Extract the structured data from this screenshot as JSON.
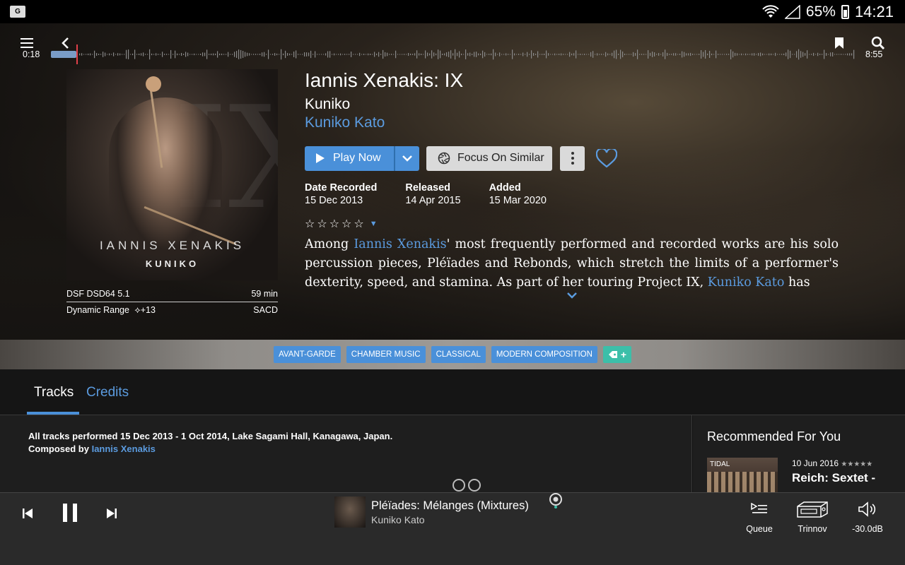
{
  "status_bar": {
    "app_icon_label": "G",
    "battery": "65%",
    "time": "14:21"
  },
  "album": {
    "title": "Iannis Xenakis: IX",
    "artist": "Kuniko",
    "performer": "Kuniko Kato",
    "cover_composer": "IANNIS XENAKIS",
    "cover_performer": "KUNIKO",
    "format": "DSF DSD64 5.1",
    "duration": "59 min",
    "dynamic_range_label": "Dynamic Range",
    "dynamic_range_value": "+13",
    "source": "SACD"
  },
  "actions": {
    "play_now": "Play Now",
    "focus_on_similar": "Focus On Similar"
  },
  "dates": {
    "recorded_label": "Date Recorded",
    "recorded_value": "15 Dec 2013",
    "released_label": "Released",
    "released_value": "14 Apr 2015",
    "added_label": "Added",
    "added_value": "15 Mar 2020"
  },
  "rating": {
    "stars": 0,
    "max": 5
  },
  "bio": {
    "part1": "Among ",
    "link1": "Iannis Xenakis",
    "part2": "' most frequently performed and recorded works are his solo percussion pieces, Pléïades and Rebonds, which stretch the limits of a performer's dexterity, speed, and stamina. As part of her touring Project IX, ",
    "link2": "Kuniko Kato",
    "part3": " has"
  },
  "genres": [
    "AVANT-GARDE",
    "CHAMBER MUSIC",
    "CLASSICAL",
    "MODERN COMPOSITION"
  ],
  "genre_add": "+",
  "tabs": {
    "tracks": "Tracks",
    "credits": "Credits"
  },
  "content": {
    "performed_line": "All tracks performed 15 Dec 2013 - 1 Oct 2014, Lake Sagami Hall, Kanagawa, Japan.",
    "composed_prefix": "Composed by ",
    "composed_link": "Iannis Xenakis"
  },
  "recommended": {
    "title": "Recommended For You",
    "item_date": "10 Jun 2016",
    "item_stars": "★★★★★",
    "item_album": "Reich: Sextet -",
    "item_source": "TIDAL"
  },
  "player": {
    "track_title": "Pléïades: Mélanges (Mixtures)",
    "track_artist": "Kuniko Kato",
    "queue_label": "Queue",
    "zone_label": "Trinnov",
    "volume_label": "-30.0dB",
    "elapsed": "0:18",
    "total": "8:55",
    "progress": 0.034
  },
  "colors": {
    "accent": "#4a90d9",
    "link": "#5b9bdf",
    "tag_add": "#3cbfa9",
    "playhead": "#e0404a"
  }
}
